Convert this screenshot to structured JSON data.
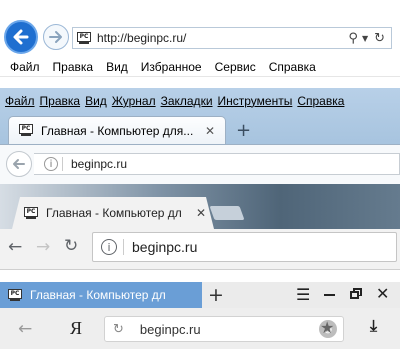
{
  "ie": {
    "address": "http://beginpc.ru/",
    "menu": [
      "Файл",
      "Правка",
      "Вид",
      "Избранное",
      "Сервис",
      "Справка"
    ],
    "icons": [
      "back-arrow-icon",
      "forward-arrow-icon",
      "search-icon",
      "dropdown-icon",
      "refresh-icon"
    ],
    "accent": "#1f6fd0"
  },
  "firefox": {
    "menu": [
      "Файл",
      "Правка",
      "Вид",
      "Журнал",
      "Закладки",
      "Инструменты",
      "Справка"
    ],
    "tab_title": "Главная - Компьютер для...",
    "address": "beginpc.ru",
    "icons": [
      "close-icon",
      "plus-icon",
      "back-arrow-icon",
      "info-icon"
    ]
  },
  "chrome": {
    "tab_title": "Главная - Компьютер дл",
    "address": "beginpc.ru",
    "icons": [
      "close-icon",
      "back-arrow-icon",
      "forward-arrow-icon",
      "reload-icon",
      "info-icon"
    ]
  },
  "yandex": {
    "tab_title": "Главная - Компьютер дл",
    "address": "beginpc.ru",
    "logo": "Я",
    "accent": "#6a9ed6",
    "icons": [
      "plus-icon",
      "menu-icon",
      "minimize-icon",
      "restore-icon",
      "close-icon",
      "back-arrow-icon",
      "reload-icon",
      "translate-icon",
      "star-icon",
      "download-icon"
    ]
  }
}
